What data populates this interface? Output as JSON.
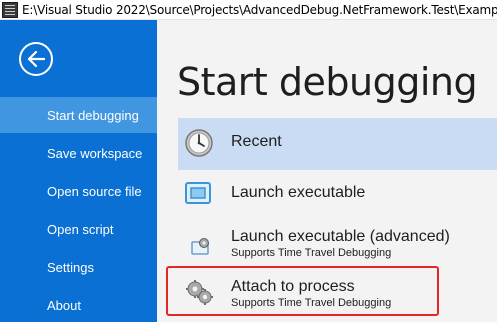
{
  "window": {
    "title": "E:\\Visual Studio 2022\\Source\\Projects\\AdvancedDebug.NetFramework.Test\\Examp"
  },
  "sidebar": {
    "back_icon": "arrow-left-icon",
    "items": [
      {
        "label": "Start debugging",
        "active": true
      },
      {
        "label": "Save workspace"
      },
      {
        "label": "Open source file"
      },
      {
        "label": "Open script"
      },
      {
        "label": "Settings"
      },
      {
        "label": "About"
      }
    ]
  },
  "main": {
    "heading": "Start debugging",
    "options": [
      {
        "label": "Recent",
        "icon": "clock-icon",
        "selected": true
      },
      {
        "label": "Launch executable",
        "icon": "window-icon"
      },
      {
        "label": "Launch executable (advanced)",
        "sublabel": "Supports Time Travel Debugging",
        "icon": "gear-window-icon"
      },
      {
        "label": "Attach to process",
        "sublabel": "Supports Time Travel Debugging",
        "icon": "gears-icon"
      }
    ]
  },
  "colors": {
    "sidebar_bg": "#0a70d4",
    "sidebar_active": "#4196e2",
    "selected_option": "#c9dcf3",
    "highlight_border": "#e32626"
  }
}
